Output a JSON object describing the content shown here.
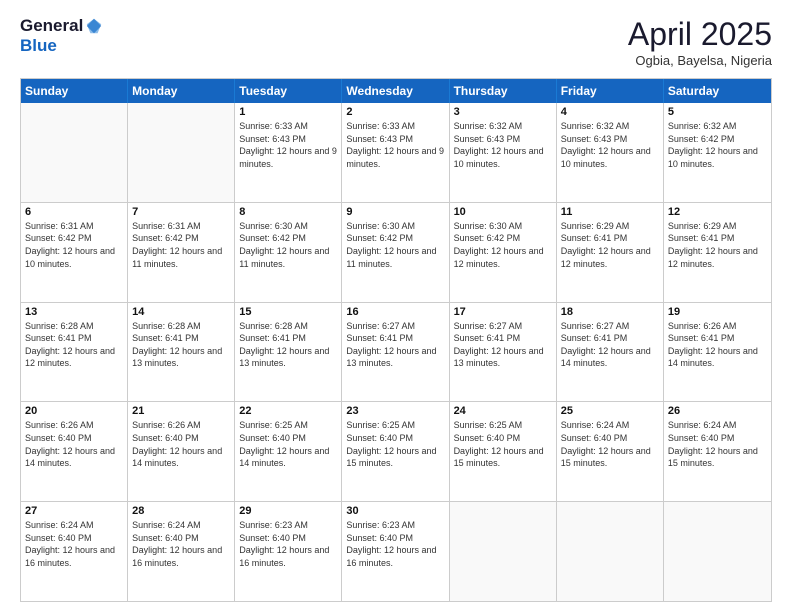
{
  "header": {
    "logo_general": "General",
    "logo_blue": "Blue",
    "main_title": "April 2025",
    "subtitle": "Ogbia, Bayelsa, Nigeria"
  },
  "calendar": {
    "days_of_week": [
      "Sunday",
      "Monday",
      "Tuesday",
      "Wednesday",
      "Thursday",
      "Friday",
      "Saturday"
    ],
    "weeks": [
      [
        {
          "day": "",
          "info": ""
        },
        {
          "day": "",
          "info": ""
        },
        {
          "day": "1",
          "info": "Sunrise: 6:33 AM\nSunset: 6:43 PM\nDaylight: 12 hours and 9 minutes."
        },
        {
          "day": "2",
          "info": "Sunrise: 6:33 AM\nSunset: 6:43 PM\nDaylight: 12 hours and 9 minutes."
        },
        {
          "day": "3",
          "info": "Sunrise: 6:32 AM\nSunset: 6:43 PM\nDaylight: 12 hours and 10 minutes."
        },
        {
          "day": "4",
          "info": "Sunrise: 6:32 AM\nSunset: 6:43 PM\nDaylight: 12 hours and 10 minutes."
        },
        {
          "day": "5",
          "info": "Sunrise: 6:32 AM\nSunset: 6:42 PM\nDaylight: 12 hours and 10 minutes."
        }
      ],
      [
        {
          "day": "6",
          "info": "Sunrise: 6:31 AM\nSunset: 6:42 PM\nDaylight: 12 hours and 10 minutes."
        },
        {
          "day": "7",
          "info": "Sunrise: 6:31 AM\nSunset: 6:42 PM\nDaylight: 12 hours and 11 minutes."
        },
        {
          "day": "8",
          "info": "Sunrise: 6:30 AM\nSunset: 6:42 PM\nDaylight: 12 hours and 11 minutes."
        },
        {
          "day": "9",
          "info": "Sunrise: 6:30 AM\nSunset: 6:42 PM\nDaylight: 12 hours and 11 minutes."
        },
        {
          "day": "10",
          "info": "Sunrise: 6:30 AM\nSunset: 6:42 PM\nDaylight: 12 hours and 12 minutes."
        },
        {
          "day": "11",
          "info": "Sunrise: 6:29 AM\nSunset: 6:41 PM\nDaylight: 12 hours and 12 minutes."
        },
        {
          "day": "12",
          "info": "Sunrise: 6:29 AM\nSunset: 6:41 PM\nDaylight: 12 hours and 12 minutes."
        }
      ],
      [
        {
          "day": "13",
          "info": "Sunrise: 6:28 AM\nSunset: 6:41 PM\nDaylight: 12 hours and 12 minutes."
        },
        {
          "day": "14",
          "info": "Sunrise: 6:28 AM\nSunset: 6:41 PM\nDaylight: 12 hours and 13 minutes."
        },
        {
          "day": "15",
          "info": "Sunrise: 6:28 AM\nSunset: 6:41 PM\nDaylight: 12 hours and 13 minutes."
        },
        {
          "day": "16",
          "info": "Sunrise: 6:27 AM\nSunset: 6:41 PM\nDaylight: 12 hours and 13 minutes."
        },
        {
          "day": "17",
          "info": "Sunrise: 6:27 AM\nSunset: 6:41 PM\nDaylight: 12 hours and 13 minutes."
        },
        {
          "day": "18",
          "info": "Sunrise: 6:27 AM\nSunset: 6:41 PM\nDaylight: 12 hours and 14 minutes."
        },
        {
          "day": "19",
          "info": "Sunrise: 6:26 AM\nSunset: 6:41 PM\nDaylight: 12 hours and 14 minutes."
        }
      ],
      [
        {
          "day": "20",
          "info": "Sunrise: 6:26 AM\nSunset: 6:40 PM\nDaylight: 12 hours and 14 minutes."
        },
        {
          "day": "21",
          "info": "Sunrise: 6:26 AM\nSunset: 6:40 PM\nDaylight: 12 hours and 14 minutes."
        },
        {
          "day": "22",
          "info": "Sunrise: 6:25 AM\nSunset: 6:40 PM\nDaylight: 12 hours and 14 minutes."
        },
        {
          "day": "23",
          "info": "Sunrise: 6:25 AM\nSunset: 6:40 PM\nDaylight: 12 hours and 15 minutes."
        },
        {
          "day": "24",
          "info": "Sunrise: 6:25 AM\nSunset: 6:40 PM\nDaylight: 12 hours and 15 minutes."
        },
        {
          "day": "25",
          "info": "Sunrise: 6:24 AM\nSunset: 6:40 PM\nDaylight: 12 hours and 15 minutes."
        },
        {
          "day": "26",
          "info": "Sunrise: 6:24 AM\nSunset: 6:40 PM\nDaylight: 12 hours and 15 minutes."
        }
      ],
      [
        {
          "day": "27",
          "info": "Sunrise: 6:24 AM\nSunset: 6:40 PM\nDaylight: 12 hours and 16 minutes."
        },
        {
          "day": "28",
          "info": "Sunrise: 6:24 AM\nSunset: 6:40 PM\nDaylight: 12 hours and 16 minutes."
        },
        {
          "day": "29",
          "info": "Sunrise: 6:23 AM\nSunset: 6:40 PM\nDaylight: 12 hours and 16 minutes."
        },
        {
          "day": "30",
          "info": "Sunrise: 6:23 AM\nSunset: 6:40 PM\nDaylight: 12 hours and 16 minutes."
        },
        {
          "day": "",
          "info": ""
        },
        {
          "day": "",
          "info": ""
        },
        {
          "day": "",
          "info": ""
        }
      ]
    ]
  }
}
